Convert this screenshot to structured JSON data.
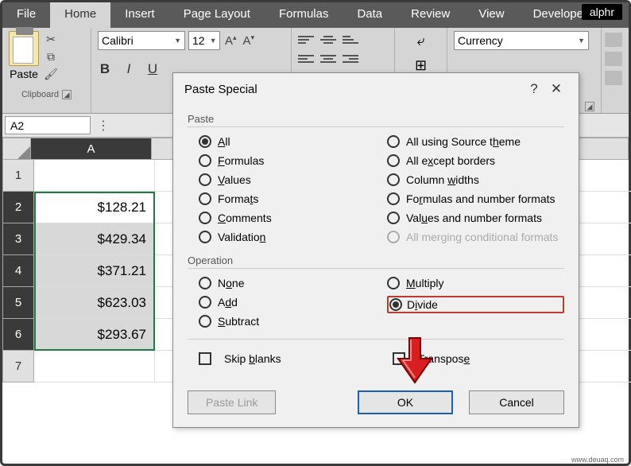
{
  "watermark": "alphr",
  "bottom_watermark": "www.deuaq.com",
  "tabs": [
    "File",
    "Home",
    "Insert",
    "Page Layout",
    "Formulas",
    "Data",
    "Review",
    "View",
    "Developer"
  ],
  "active_tab": "Home",
  "ribbon": {
    "clipboard": {
      "paste_label": "Paste",
      "group_label": "Clipboard"
    },
    "font": {
      "name": "Calibri",
      "size": "12",
      "bold": "B",
      "italic": "I",
      "underline": "U"
    },
    "number": {
      "format": "Currency"
    }
  },
  "namebox": "A2",
  "columns": {
    "A": "A"
  },
  "rows": [
    "1",
    "2",
    "3",
    "4",
    "5",
    "6",
    "7"
  ],
  "values": {
    "2": "$128.21",
    "3": "$429.34",
    "4": "$371.21",
    "5": "$623.03",
    "6": "$293.67"
  },
  "dialog": {
    "title": "Paste Special",
    "help": "?",
    "close": "✕",
    "paste_label": "Paste",
    "operation_label": "Operation",
    "paste_opts_left": [
      {
        "key": "all",
        "label_pre": "",
        "u": "A",
        "label_post": "ll",
        "checked": true
      },
      {
        "key": "formulas",
        "label_pre": "",
        "u": "F",
        "label_post": "ormulas"
      },
      {
        "key": "values",
        "label_pre": "",
        "u": "V",
        "label_post": "alues"
      },
      {
        "key": "formats",
        "label_pre": "Forma",
        "u": "t",
        "label_post": "s"
      },
      {
        "key": "comments",
        "label_pre": "",
        "u": "C",
        "label_post": "omments"
      },
      {
        "key": "validation",
        "label_pre": "Validatio",
        "u": "n",
        "label_post": ""
      }
    ],
    "paste_opts_right": [
      {
        "key": "theme",
        "label_pre": "All using Source t",
        "u": "h",
        "label_post": "eme"
      },
      {
        "key": "borders",
        "label_pre": "All e",
        "u": "x",
        "label_post": "cept borders"
      },
      {
        "key": "widths",
        "label_pre": "Column ",
        "u": "w",
        "label_post": "idths"
      },
      {
        "key": "fnum",
        "label_pre": "Fo",
        "u": "r",
        "label_post": "mulas and number formats"
      },
      {
        "key": "vnum",
        "label_pre": "Val",
        "u": "u",
        "label_post": "es and number formats"
      },
      {
        "key": "merge",
        "label_pre": "All mer",
        "u": "g",
        "label_post": "ing conditional formats",
        "disabled": true
      }
    ],
    "op_left": [
      {
        "key": "none",
        "label_pre": "N",
        "u": "o",
        "label_post": "ne"
      },
      {
        "key": "add",
        "label_pre": "A",
        "u": "d",
        "label_post": "d"
      },
      {
        "key": "sub",
        "label_pre": "",
        "u": "S",
        "label_post": "ubtract"
      }
    ],
    "op_right": [
      {
        "key": "mul",
        "label_pre": "",
        "u": "M",
        "label_post": "ultiply"
      },
      {
        "key": "div",
        "label_pre": "D",
        "u": "i",
        "label_post": "vide",
        "checked": true,
        "boxed": true
      }
    ],
    "skip": {
      "label_pre": "Skip ",
      "u": "b",
      "label_post": "lanks"
    },
    "transpose": {
      "label_pre": "Transpos",
      "u": "e",
      "label_post": ""
    },
    "paste_link": "Paste Link",
    "ok": "OK",
    "cancel": "Cancel"
  }
}
